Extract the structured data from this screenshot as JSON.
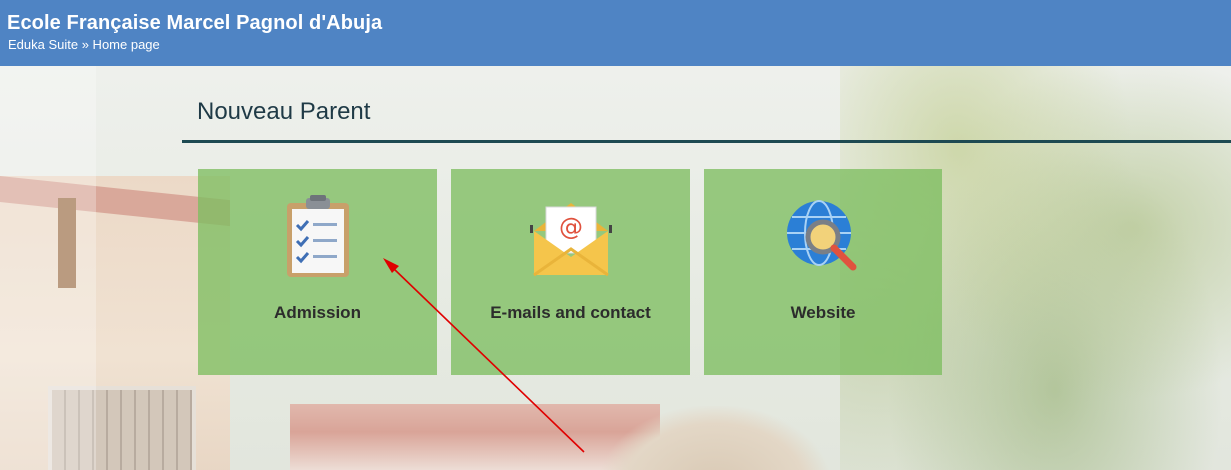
{
  "header": {
    "title": "Ecole Française Marcel Pagnol d'Abuja",
    "breadcrumb": "Eduka Suite » Home page"
  },
  "section": {
    "title": "Nouveau Parent"
  },
  "tiles": [
    {
      "label": "Admission",
      "icon": "clipboard-checklist-icon"
    },
    {
      "label": "E-mails and contact",
      "icon": "envelope-at-icon"
    },
    {
      "label": "Website",
      "icon": "globe-magnifier-icon"
    }
  ],
  "colors": {
    "header_bg": "#4f84c4",
    "tile_bg": "#7ebe60",
    "rule": "#1e4a52",
    "annotation_arrow": "#e00000"
  }
}
